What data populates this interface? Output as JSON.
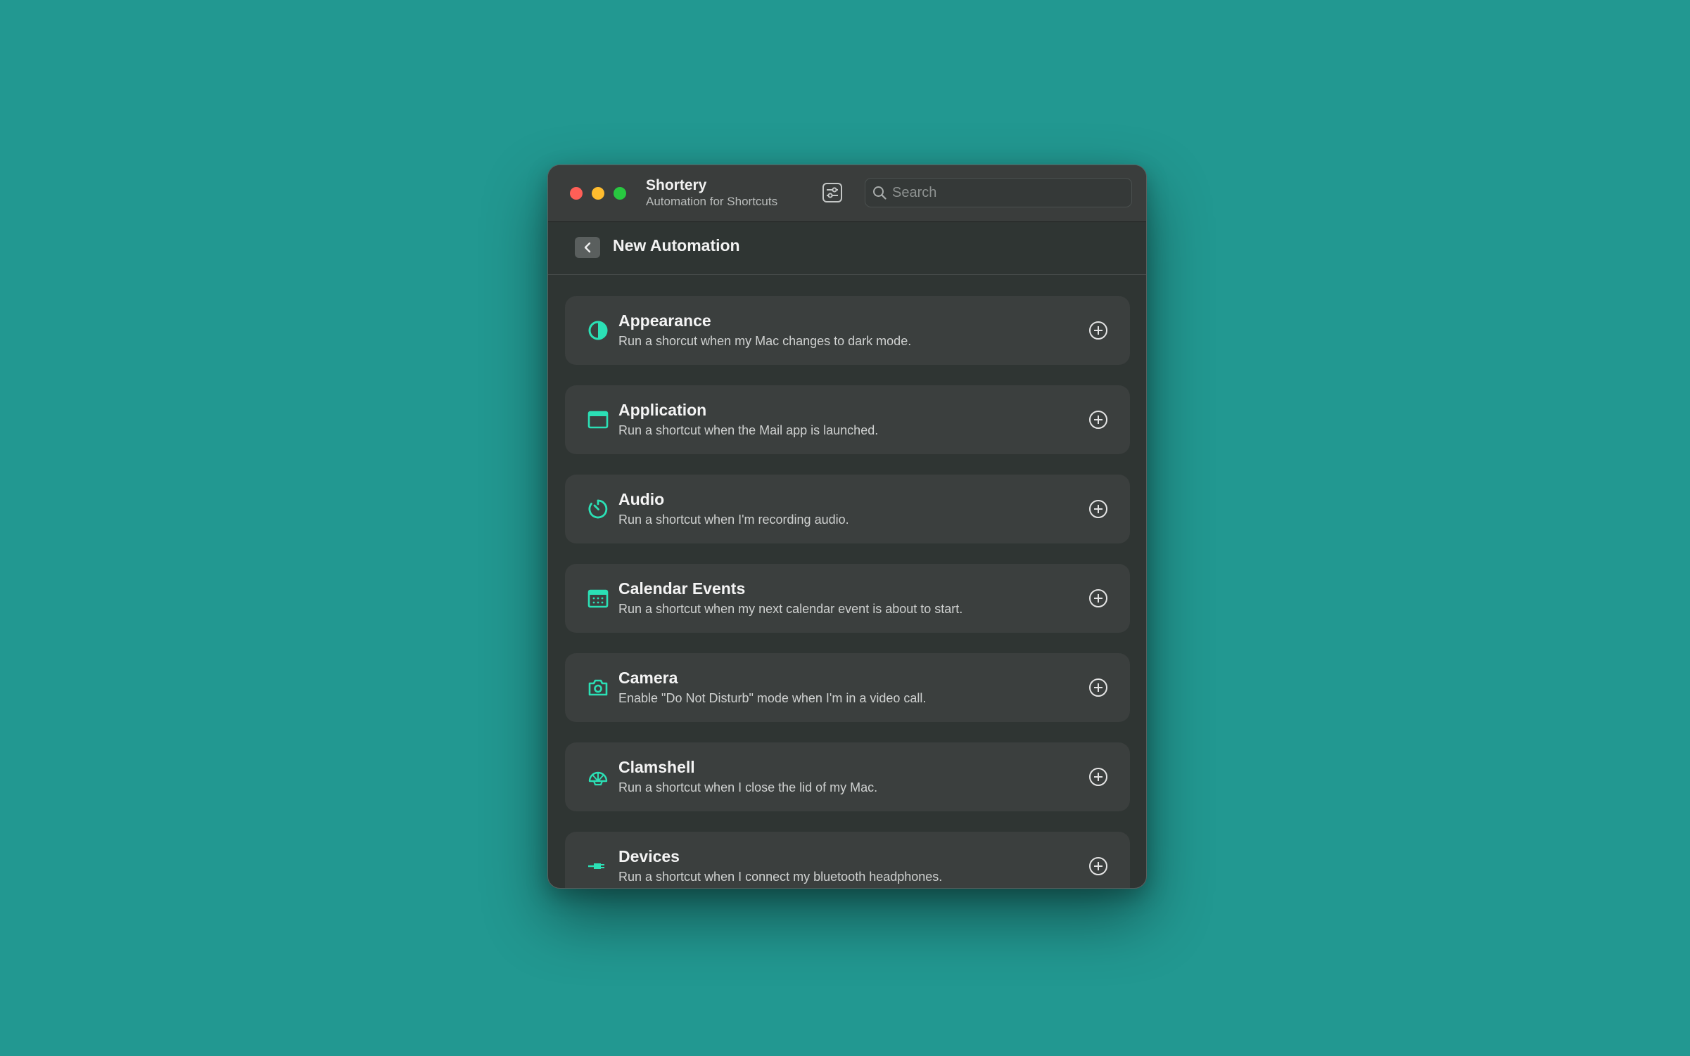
{
  "window": {
    "app_title": "Shortery",
    "app_subtitle": "Automation for Shortcuts"
  },
  "search": {
    "placeholder": "Search",
    "value": ""
  },
  "header": {
    "title": "New Automation"
  },
  "accent_color": "#2be0b5",
  "items": [
    {
      "title": "Appearance",
      "description": "Run a shorcut when my Mac changes to dark mode.",
      "icon": "half-circle-icon"
    },
    {
      "title": "Application",
      "description": "Run a shortcut when the Mail app is launched.",
      "icon": "app-window-icon"
    },
    {
      "title": "Audio",
      "description": "Run a shortcut when I'm recording audio.",
      "icon": "timer-icon"
    },
    {
      "title": "Calendar Events",
      "description": "Run a shortcut when my next calendar event is about to start.",
      "icon": "calendar-icon"
    },
    {
      "title": "Camera",
      "description": "Enable \"Do Not Disturb\" mode when I'm in a video call.",
      "icon": "camera-icon"
    },
    {
      "title": "Clamshell",
      "description": "Run a shortcut when I close the lid of my Mac.",
      "icon": "shell-icon"
    },
    {
      "title": "Devices",
      "description": "Run a shortcut when I connect my bluetooth headphones.",
      "icon": "cable-icon"
    }
  ]
}
